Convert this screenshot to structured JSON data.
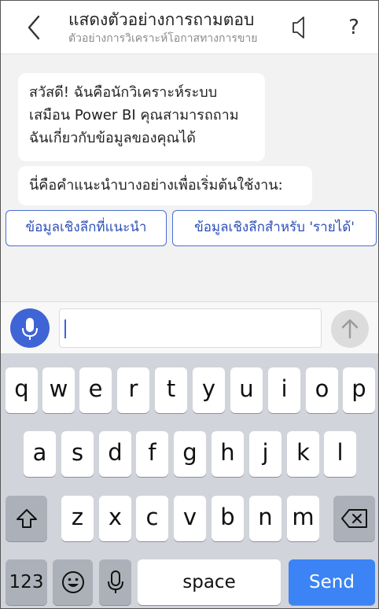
{
  "header": {
    "title": "แสดงตัวอย่างการถามตอบ",
    "subtitle": "ตัวอย่างการวิเคราะห์โอกาสทางการขาย",
    "back_icon": "chevron-left-icon",
    "speaker_icon": "speaker-icon",
    "help_label": "?"
  },
  "chat": {
    "greeting_lines": [
      "สวัสดี! ฉันคือนักวิเคราะห์ระบบ",
      "เสมือน Power BI คุณสามารถถาม",
      "ฉันเกี่ยวกับข้อมูลของคุณได้"
    ],
    "suggestions_intro": "นี่คือคำแนะนำบางอย่างเพื่อเริ่มต้นใช้งาน:",
    "suggestions": [
      "ข้อมูลเชิงลึกที่แนะนำ",
      "ข้อมูลเชิงลึกสำหรับ 'รายได้'"
    ]
  },
  "input": {
    "value": "",
    "mic_icon": "microphone-icon",
    "send_icon": "arrow-up-icon"
  },
  "keyboard": {
    "row1": [
      "q",
      "w",
      "e",
      "r",
      "t",
      "y",
      "u",
      "i",
      "o",
      "p"
    ],
    "row2": [
      "a",
      "s",
      "d",
      "f",
      "g",
      "h",
      "j",
      "k",
      "l"
    ],
    "row3": [
      "z",
      "x",
      "c",
      "v",
      "b",
      "n",
      "m"
    ],
    "shift_icon": "shift-icon",
    "backspace_icon": "backspace-icon",
    "numbers_label": "123",
    "emoji_icon": "emoji-icon",
    "dictation_icon": "microphone-icon",
    "space_label": "space",
    "send_label": "Send"
  },
  "colors": {
    "accent": "#3f64d6",
    "send_key": "#3c83f5",
    "keyboard_bg": "#d1d4da"
  }
}
